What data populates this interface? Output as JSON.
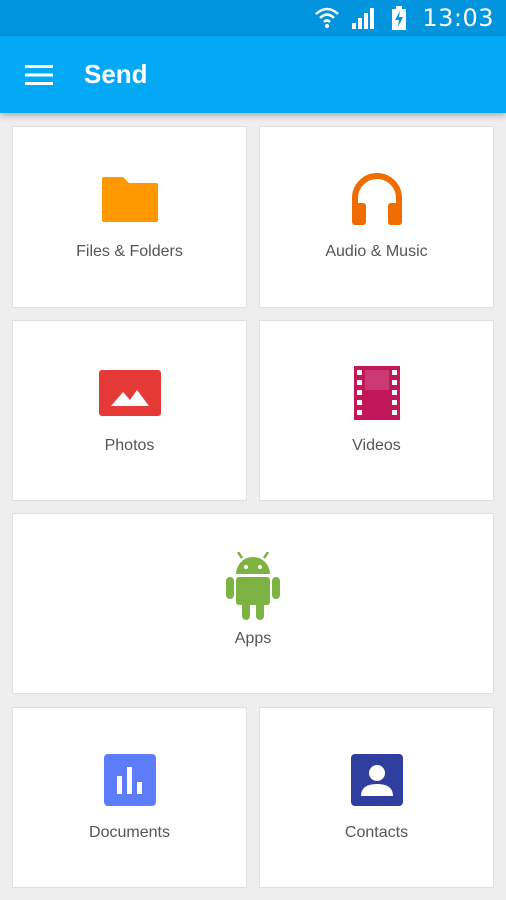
{
  "status_bar": {
    "time": "13:03",
    "icons": [
      "wifi-icon",
      "signal-icon",
      "battery-charging-icon"
    ]
  },
  "app_bar": {
    "title": "Send",
    "menu_icon": "hamburger-menu-icon"
  },
  "categories": [
    {
      "label": "Files & Folders",
      "icon": "folder-icon",
      "color": "#ff9800"
    },
    {
      "label": "Audio & Music",
      "icon": "headphones-icon",
      "color": "#ef6c00"
    },
    {
      "label": "Photos",
      "icon": "image-icon",
      "color": "#e53935"
    },
    {
      "label": "Videos",
      "icon": "film-icon",
      "color": "#c2185b"
    },
    {
      "label": "Apps",
      "icon": "android-icon",
      "color": "#7cb342"
    },
    {
      "label": "Documents",
      "icon": "bar-chart-document-icon",
      "color": "#5c7cfa"
    },
    {
      "label": "Contacts",
      "icon": "contact-card-icon",
      "color": "#303f9f"
    }
  ],
  "colors": {
    "status_bar": "#0294dd",
    "app_bar": "#03a9f4",
    "background": "#eeeeee"
  }
}
